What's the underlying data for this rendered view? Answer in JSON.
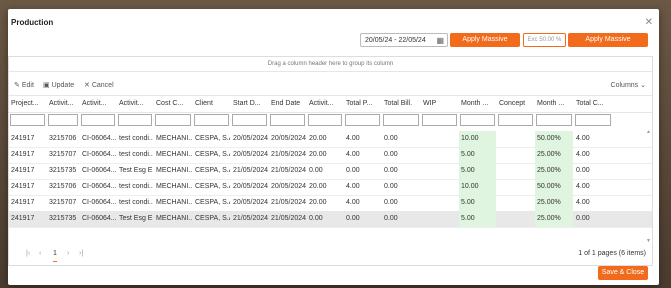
{
  "dialog": {
    "title": "Production",
    "close_icon": "close-icon"
  },
  "header": {
    "date_range": "20/05/24 - 22/05/24",
    "apply_concept": "Apply Massive Concept",
    "exc_placeholder": "Exc 50.00 %",
    "apply_production": "Apply Massive Production"
  },
  "grid": {
    "group_hint": "Drag a column header here to group its column",
    "toolbar": {
      "edit": "Edit",
      "update": "Update",
      "cancel": "Cancel",
      "columns": "Columns"
    },
    "columns": [
      "Project...",
      "Activit...",
      "Activit...",
      "Activit...",
      "Cost C...",
      "Client",
      "Start D...",
      "End Date",
      "Activit...",
      "Total P...",
      "Total Bill.",
      "WIP",
      "Month ...",
      "Concept",
      "Month ...",
      "Total C..."
    ],
    "rows": [
      [
        "241917",
        "3215706",
        "CI-06064...",
        "test condi...",
        "MECHANI...",
        "CESPA, S.A.",
        "20/05/2024",
        "20/05/2024",
        "20.00",
        "4.00",
        "0.00",
        "",
        "10.00",
        "",
        "50.00%",
        "4.00"
      ],
      [
        "241917",
        "3215707",
        "CI-06064...",
        "test condi...",
        "MECHANI...",
        "CESPA, S.A.",
        "20/05/2024",
        "21/05/2024",
        "20.00",
        "4.00",
        "0.00",
        "",
        "5.00",
        "",
        "25.00%",
        "4.00"
      ],
      [
        "241917",
        "3215735",
        "CI-06064...",
        "Test Esg E...",
        "MECHANI...",
        "CESPA, S.A.",
        "21/05/2024",
        "21/05/2024",
        "0.00",
        "0.00",
        "0.00",
        "",
        "5.00",
        "",
        "25.00%",
        "0.00"
      ],
      [
        "241917",
        "3215706",
        "CI-06064...",
        "test condi...",
        "MECHANI...",
        "CESPA, S.A.",
        "20/05/2024",
        "20/05/2024",
        "20.00",
        "4.00",
        "0.00",
        "",
        "10.00",
        "",
        "50.00%",
        "4.00"
      ],
      [
        "241917",
        "3215707",
        "CI-06064...",
        "test condi...",
        "MECHANI...",
        "CESPA, S.A.",
        "20/05/2024",
        "21/05/2024",
        "20.00",
        "4.00",
        "0.00",
        "",
        "5.00",
        "",
        "25.00%",
        "4.00"
      ],
      [
        "241917",
        "3215735",
        "CI-06064...",
        "Test Esg E...",
        "MECHANI...",
        "CESPA, S.A.",
        "21/05/2024",
        "21/05/2024",
        "0.00",
        "0.00",
        "0.00",
        "",
        "5.00",
        "",
        "25.00%",
        "0.00"
      ]
    ],
    "selected_row": 5
  },
  "pager": {
    "first": "|‹",
    "prev": "‹",
    "page": "1",
    "next": "›",
    "last": "›|",
    "summary": "1 of 1 pages (6 items)"
  },
  "footer": {
    "save_close": "Save & Close"
  },
  "colors": {
    "accent": "#f26b1d",
    "highlight": "#dff5df"
  }
}
